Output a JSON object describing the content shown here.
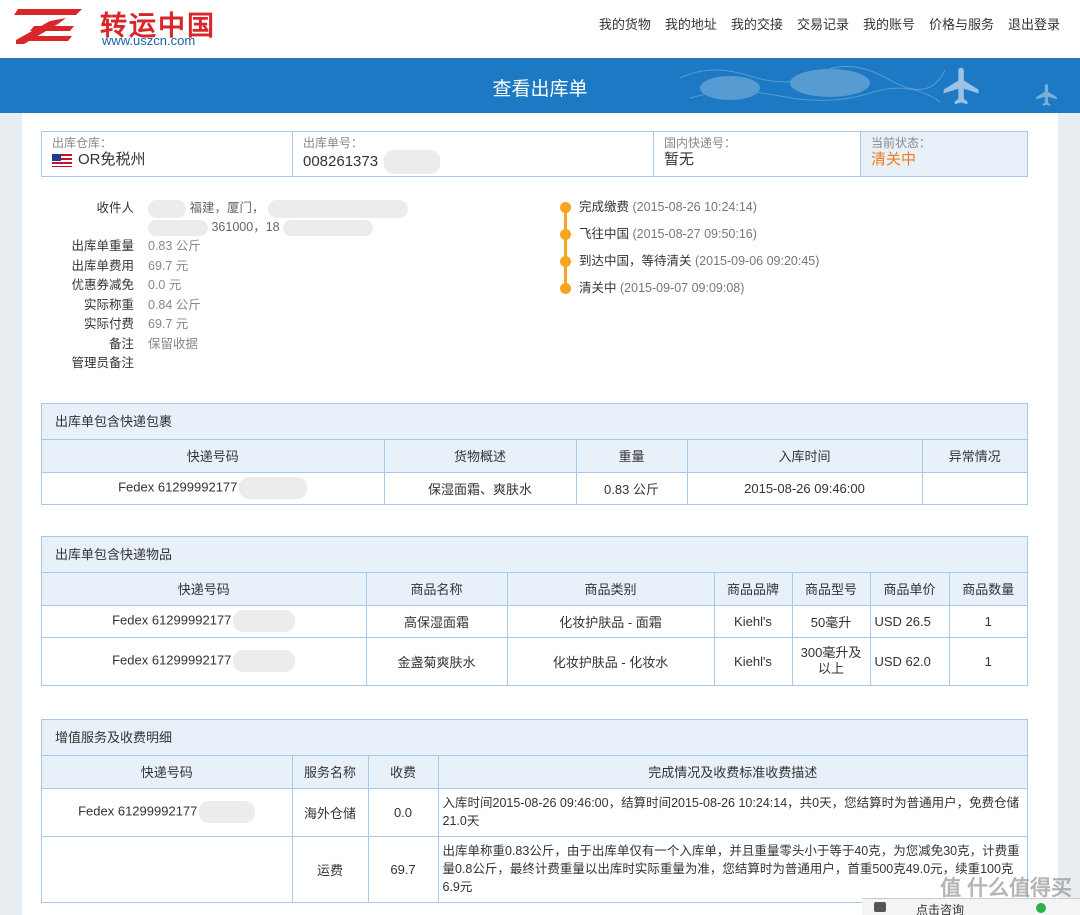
{
  "logo": {
    "name": "转运中国",
    "url": "www.uszcn.com"
  },
  "nav": [
    "我的货物",
    "我的地址",
    "我的交接",
    "交易记录",
    "我的账号",
    "价格与服务",
    "退出登录"
  ],
  "page_title": "查看出库单",
  "info": {
    "warehouse_label": "出库仓库：",
    "warehouse_value": "OR免税州",
    "order_label": "出库单号：",
    "order_value": "008261373",
    "domestic_label": "国内快递号：",
    "domestic_value": "暂无",
    "status_label": "当前状态：",
    "status_value": "清关中"
  },
  "details": {
    "recipient_label": "收件人",
    "recipient_line1": "福建，厦门，",
    "recipient_line2": "361000，18",
    "rows": [
      {
        "k": "出库单重量",
        "v": "0.83 公斤"
      },
      {
        "k": "出库单费用",
        "v": "69.7 元"
      },
      {
        "k": "优惠券减免",
        "v": "0.0 元"
      },
      {
        "k": "实际称重",
        "v": "0.84 公斤"
      },
      {
        "k": "实际付费",
        "v": "69.7 元"
      },
      {
        "k": "备注",
        "v": "保留收据"
      },
      {
        "k": "管理员备注",
        "v": ""
      }
    ]
  },
  "timeline": [
    {
      "label": "完成缴费",
      "time": "(2015-08-26 10:24:14)"
    },
    {
      "label": "飞往中国",
      "time": "(2015-08-27 09:50:16)"
    },
    {
      "label": "到达中国，等待清关",
      "time": "(2015-09-06 09:20:45)"
    },
    {
      "label": "清关中",
      "time": "(2015-09-07 09:09:08)"
    }
  ],
  "packages": {
    "title": "出库单包含快递包裹",
    "headers": [
      "快递号码",
      "货物概述",
      "重量",
      "入库时间",
      "异常情况"
    ],
    "rows": [
      [
        "Fedex 61299992177",
        "保湿面霜、爽肤水",
        "0.83 公斤",
        "2015-08-26 09:46:00",
        ""
      ]
    ]
  },
  "items": {
    "title": "出库单包含快递物品",
    "headers": [
      "快递号码",
      "商品名称",
      "商品类别",
      "商品品牌",
      "商品型号",
      "商品单价",
      "商品数量"
    ],
    "rows": [
      [
        "Fedex 61299992177",
        "高保湿面霜",
        "化妆护肤品 - 面霜",
        "Kiehl's",
        "50毫升",
        "USD 26.5",
        "1"
      ],
      [
        "Fedex 61299992177",
        "金盏菊爽肤水",
        "化妆护肤品 - 化妆水",
        "Kiehl's",
        "300毫升及以上",
        "USD 62.0",
        "1"
      ]
    ]
  },
  "services": {
    "title": "增值服务及收费明细",
    "headers": [
      "快递号码",
      "服务名称",
      "收费",
      "完成情况及收费标准收费描述"
    ],
    "rows": [
      [
        "Fedex 61299992177",
        "海外仓储",
        "0.0",
        "入库时间2015-08-26 09:46:00，结算时间2015-08-26 10:24:14，共0天，您结算时为普通用户，免费仓储21.0天"
      ],
      [
        "",
        "运费",
        "69.7",
        "出库单称重0.83公斤，由于出库单仅有一个入库单，并且重量零头小于等于40克，为您减免30克，计费重量0.8公斤，最终计费重量以出库时实际重量为准，您结算时为普通用户，首重500克49.0元，续重100克6.9元"
      ]
    ]
  },
  "bottombar": {
    "consult": "点击咨询"
  },
  "watermark": "值 什么值得买",
  "colors": {
    "banner": "#1d79c3",
    "accent_orange": "#f07a1b",
    "timeline": "#f5a51f",
    "border": "#a7c8e6",
    "header_bg": "#e8f1f9"
  }
}
